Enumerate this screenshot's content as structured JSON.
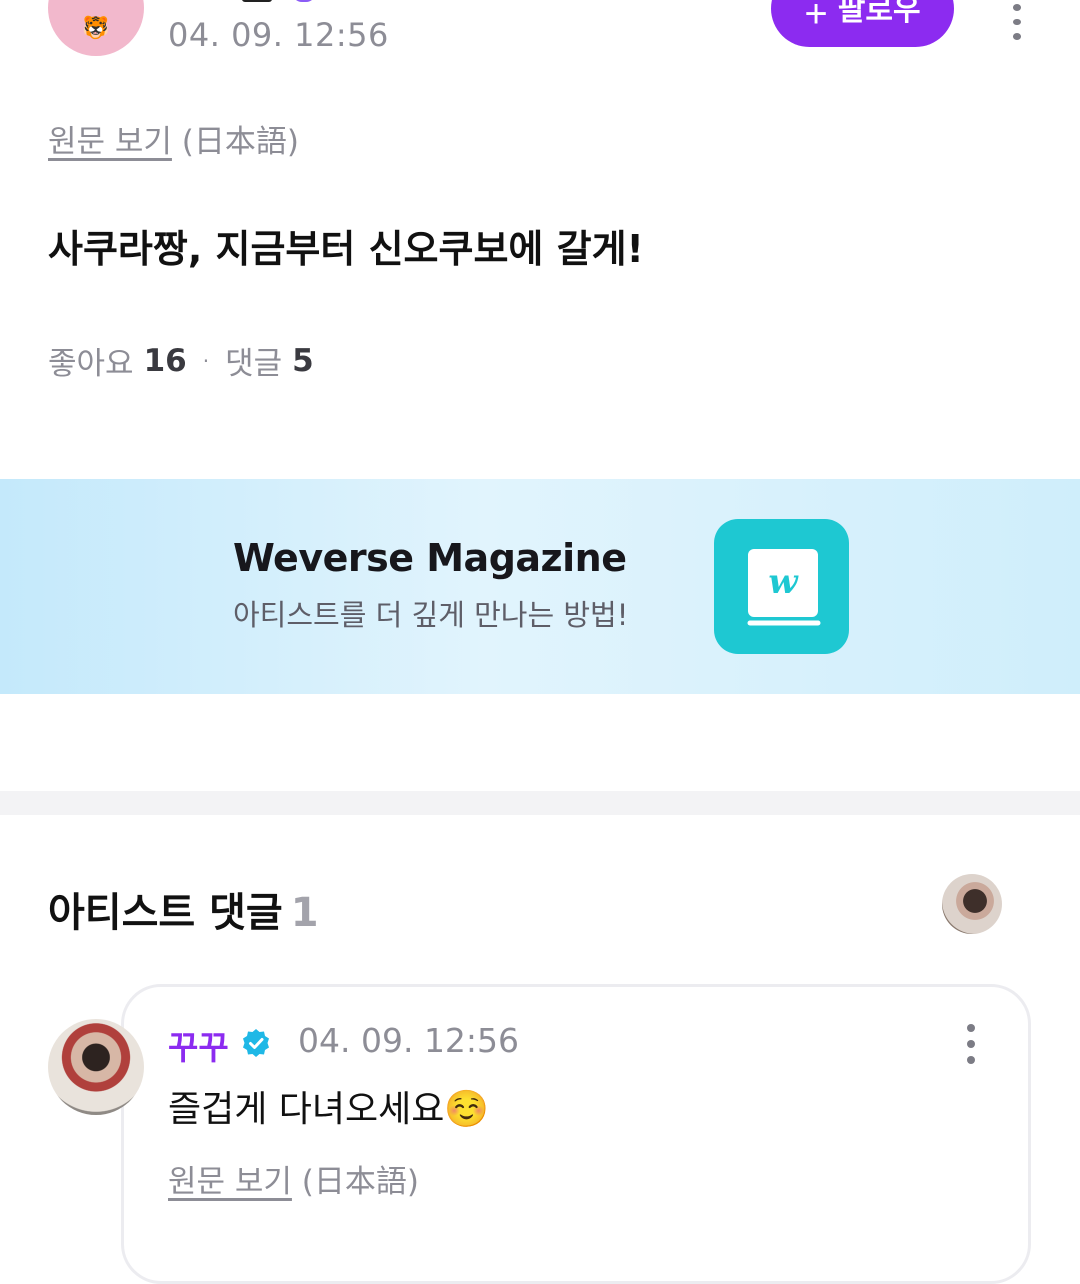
{
  "post": {
    "avatar_icon": "tiger-face-icon",
    "timestamp": "04. 09. 12:56",
    "follow_label": "팔로우",
    "view_original": "원문 보기",
    "original_lang": "(日本語)",
    "text": "사쿠라짱, 지금부터 신오쿠보에 갈게!",
    "likes_label": "좋아요",
    "likes_count": "16",
    "comments_label": "댓글",
    "comments_count": "5"
  },
  "banner": {
    "title": "Weverse Magazine",
    "subtitle": "아티스트를 더 깊게 만나는 방법!",
    "icon": "weverse-magazine-book-icon",
    "bg_color": "#c4e9fb",
    "icon_color": "#1ec8d2"
  },
  "artist_comments": {
    "heading": "아티스트 댓글",
    "count": "1",
    "comment": {
      "author": "꾸꾸",
      "timestamp": "04. 09. 12:56",
      "text": "즐겁게 다녀오세요☺️",
      "view_original": "원문 보기",
      "original_lang": "(日本語)"
    }
  },
  "colors": {
    "accent": "#8c2bf0",
    "verified": "#1fb8e6",
    "muted_text": "#8d8d96"
  }
}
